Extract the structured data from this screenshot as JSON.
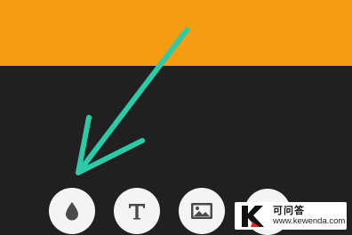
{
  "colors": {
    "top_bar": "#f59d12",
    "background": "#202020",
    "arrow": "#2ec9a6",
    "button_bg": "#f4f4f4",
    "icon": "#4a4a4a",
    "watermark_red": "#e8261c"
  },
  "toolbar": {
    "buttons": [
      {
        "icon": "water-drop-icon",
        "glyph": ""
      },
      {
        "icon": "text-icon",
        "glyph": "T"
      },
      {
        "icon": "image-icon",
        "glyph": ""
      },
      {
        "icon": "camera-icon",
        "glyph": ""
      }
    ]
  },
  "watermark": {
    "logo_letter": "K",
    "title": "可问答",
    "url": "www.kewenda.com"
  }
}
